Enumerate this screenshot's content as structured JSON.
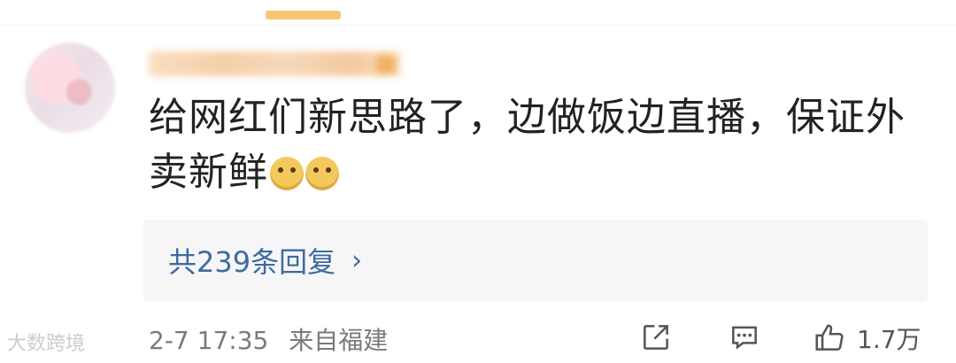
{
  "comment": {
    "text": "给网红们新思路了，边做饭边直播，保证外卖新鲜"
  },
  "replies": {
    "label": "共239条回复",
    "arrow": "›"
  },
  "meta": {
    "date": "2-7 17:35",
    "location": "来自福建"
  },
  "actions": {
    "like_count": "1.7万"
  },
  "watermark": {
    "text": "大数跨境"
  },
  "icons": [
    "share-icon",
    "comment-icon",
    "like-icon",
    "doge-emoji",
    "chevron-right-icon"
  ],
  "colors": {
    "accent": "#3e6aa2",
    "reply_bg": "#f6f6f6",
    "top_bar": "#f5c773"
  }
}
